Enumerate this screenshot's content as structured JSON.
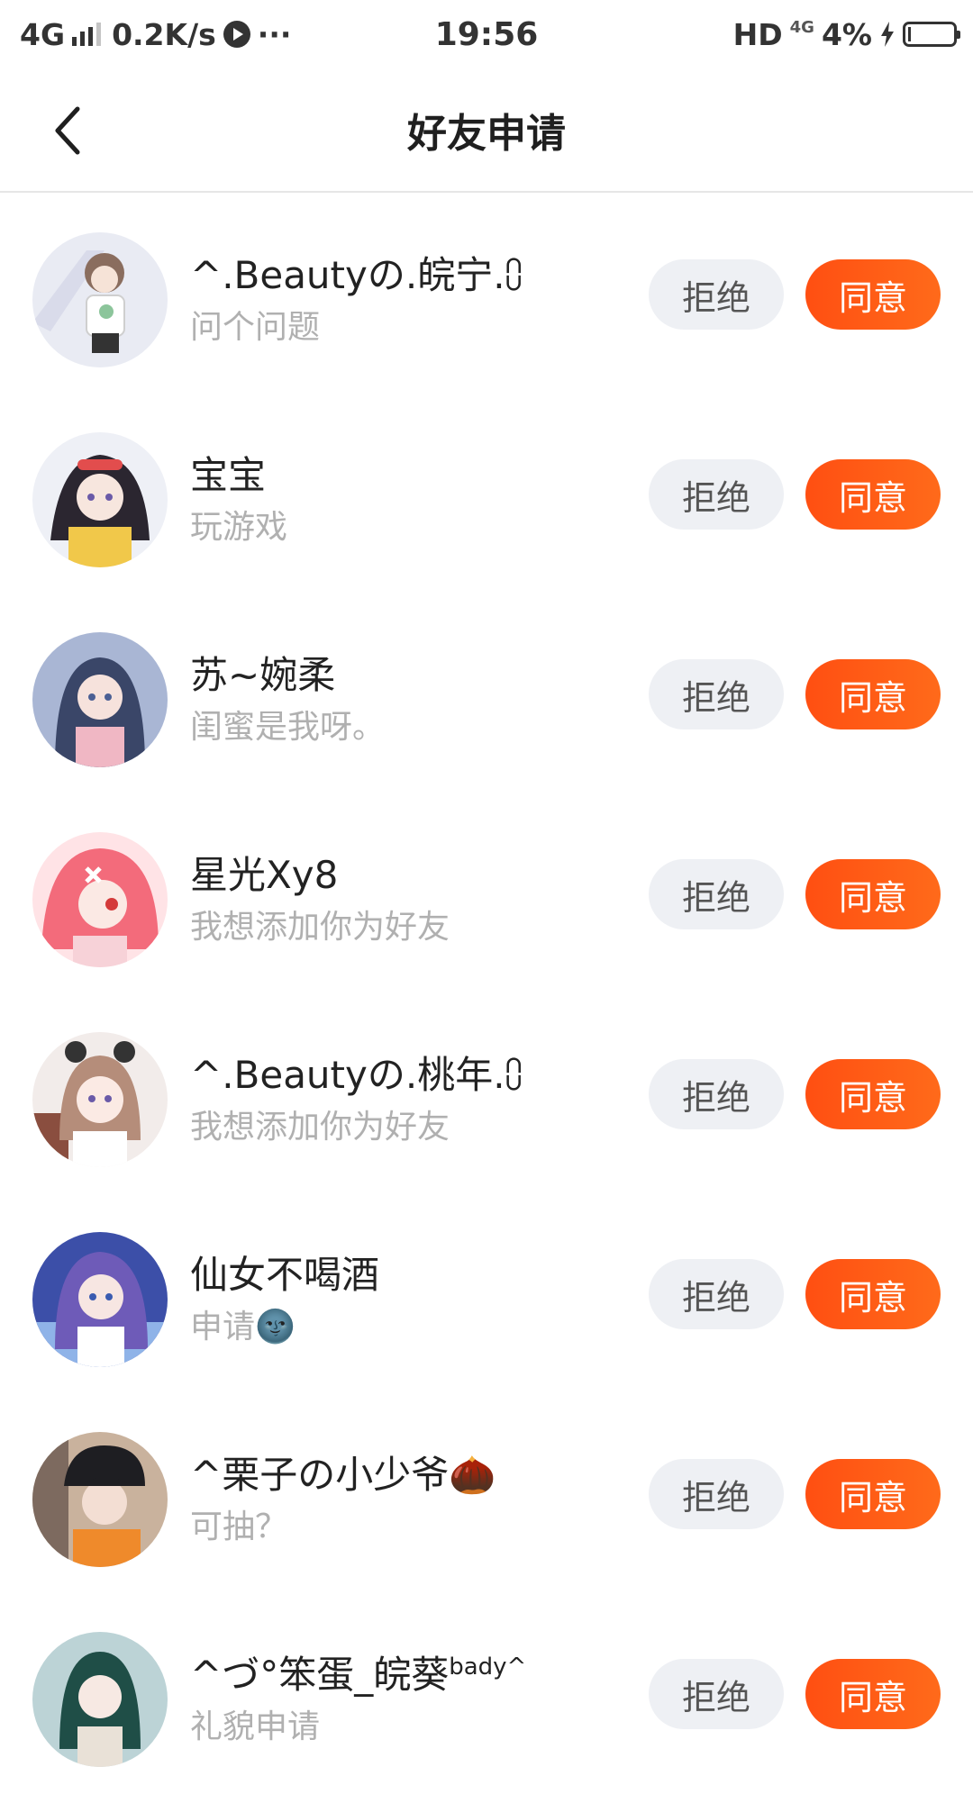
{
  "status_bar": {
    "network": "4G",
    "speed": "0.2K/s",
    "more": "···",
    "time": "19:56",
    "hd": "HD",
    "network_small": "4G",
    "battery": "4%"
  },
  "header": {
    "title": "好友申请"
  },
  "buttons": {
    "reject_label": "拒绝",
    "accept_label": "同意"
  },
  "colors": {
    "accent": "#ff5a14",
    "reject_bg": "#eef0f4"
  },
  "requests": [
    {
      "name": "^.Beautyの.皖宁.⩇",
      "message": "问个问题"
    },
    {
      "name": "宝宝",
      "message": "玩游戏"
    },
    {
      "name": "苏~婉柔",
      "message": "闺蜜是我呀。"
    },
    {
      "name": "星光Xy8",
      "message": "我想添加你为好友"
    },
    {
      "name": "^.Beautyの.桃年.⩇",
      "message": "我想添加你为好友"
    },
    {
      "name": "仙女不喝酒",
      "message": "申请🌚"
    },
    {
      "name": "^栗子の小少爷🌰",
      "message": "可抽？"
    },
    {
      "name": "^づ°笨蛋_皖葵",
      "name_sup": "bady^",
      "message": "礼貌申请"
    }
  ]
}
